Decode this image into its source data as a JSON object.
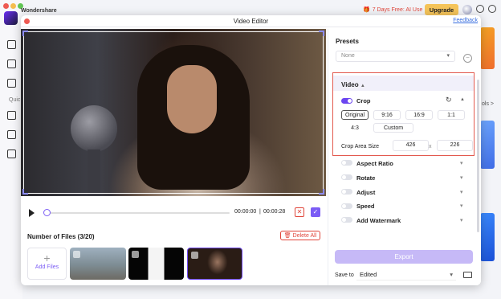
{
  "background_app": {
    "brand": "Wondershare",
    "quick_label": "Quic",
    "tools_label": "ols >",
    "promo": "7 Days Free: AI Use",
    "upgrade_label": "Upgrade"
  },
  "modal": {
    "title": "Video Editor",
    "feedback_label": "Feedback"
  },
  "player": {
    "current_time": "00:00:00",
    "separator": "|",
    "duration": "00:00:28"
  },
  "files": {
    "count_label": "Number of Files (3/20)",
    "delete_all_label": "Delete All",
    "add_files_label": "Add Files"
  },
  "panel": {
    "presets_title": "Presets",
    "preset_value": "None",
    "video_section": "Video",
    "crop": {
      "label": "Crop",
      "enabled": true,
      "ratios": [
        "Original",
        "9:16",
        "16:9",
        "1:1",
        "4:3",
        "Custom"
      ],
      "selected_ratio": "Original",
      "size_label": "Crop Area Size",
      "width": "426",
      "height": "226",
      "times": "x"
    },
    "options": [
      {
        "label": "Aspect Ratio",
        "enabled": false
      },
      {
        "label": "Rotate",
        "enabled": false
      },
      {
        "label": "Adjust",
        "enabled": false
      },
      {
        "label": "Speed",
        "enabled": false
      },
      {
        "label": "Add Watermark",
        "enabled": false
      }
    ],
    "export_label": "Export",
    "save_to_label": "Save to",
    "save_to_value": "Edited"
  },
  "colors": {
    "accent": "#6b45f0",
    "danger": "#e0453a",
    "highlight_box": "#e35a4f"
  }
}
